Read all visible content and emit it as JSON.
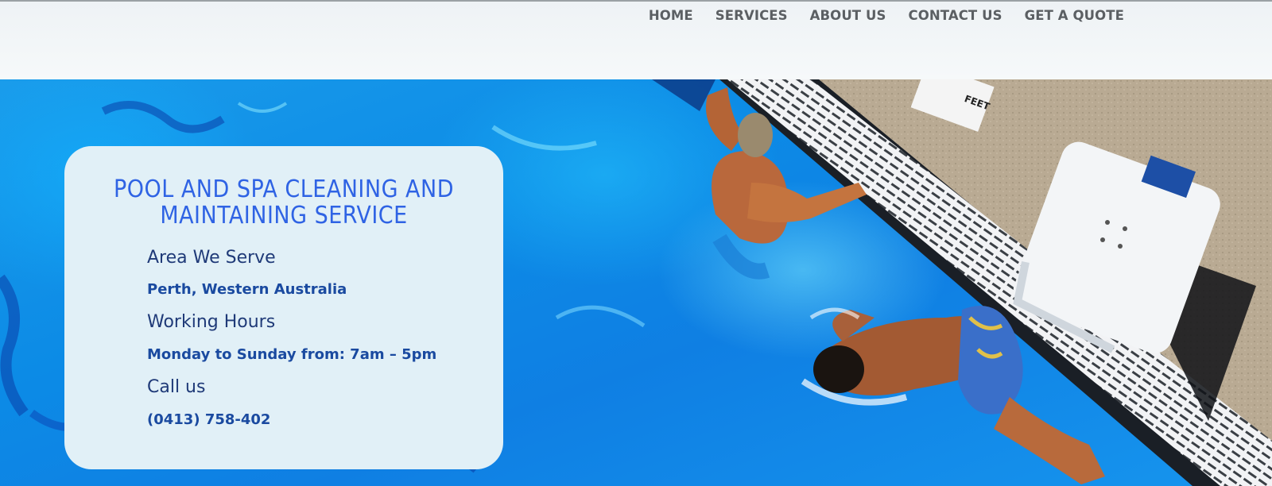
{
  "nav": {
    "items": [
      "HOME",
      "SERVICES",
      "ABOUT US",
      "CONTACT US",
      "GET A QUOTE"
    ]
  },
  "hero": {
    "image_alt": "Swimmers in a pool next to a starting block",
    "sign_text": "FEET"
  },
  "card": {
    "title_line1": "POOL AND SPA CLEANING AND",
    "title_line2": "MAINTAINING SERVICE",
    "area_label": "Area We Serve",
    "area_value": "Perth, Western Australia",
    "hours_label": "Working Hours",
    "hours_value": "Monday to Sunday from: 7am – 5pm",
    "call_label": "Call us",
    "call_value": "(0413) 758-402"
  },
  "colors": {
    "accent": "#2f63e4",
    "card_bg": "#e1f0f7",
    "pool_blue": "#0f8ae6",
    "nav_text": "#5b5f63"
  }
}
